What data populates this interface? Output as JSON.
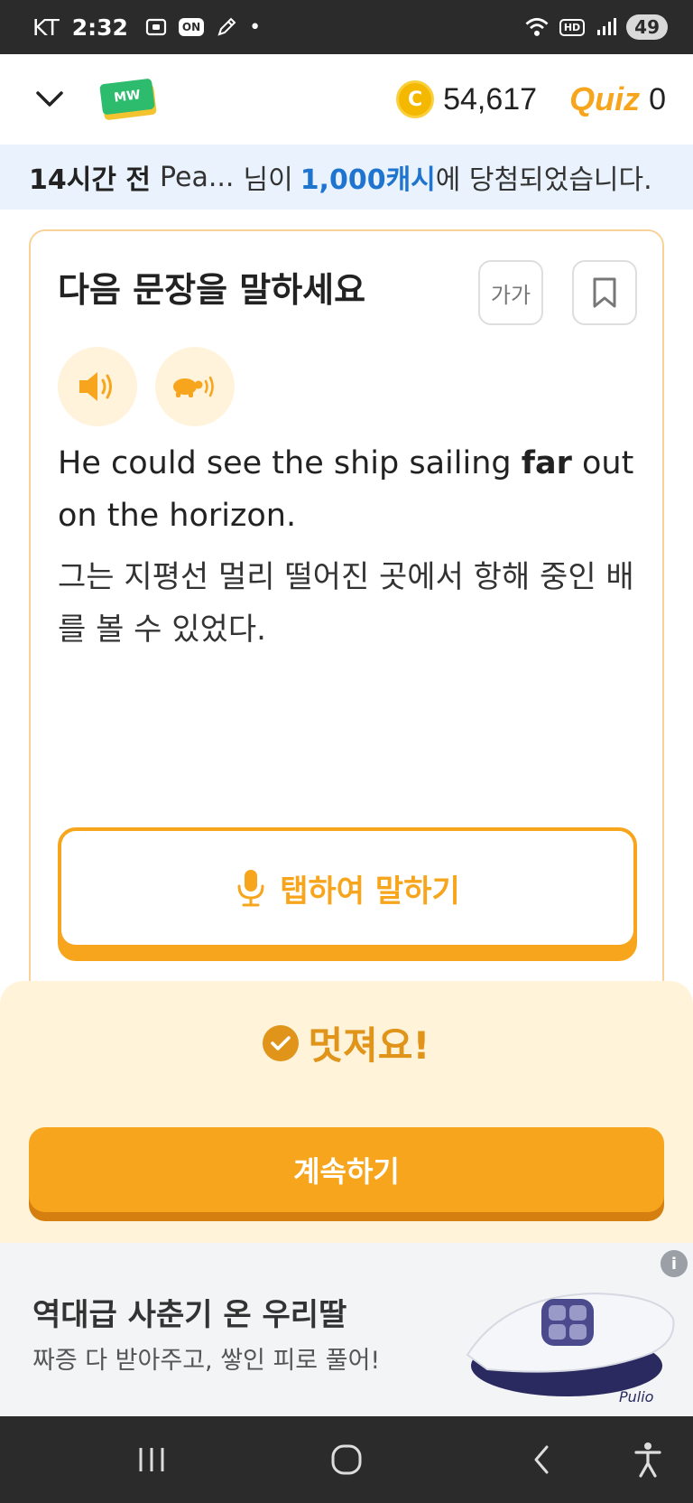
{
  "status_bar": {
    "carrier": "KT",
    "time": "2:32",
    "on_badge": "ON",
    "dot": "•",
    "hd_badge": "HD",
    "battery": "49",
    "icons": [
      "screenshot-icon",
      "pen-icon",
      "wifi-icon",
      "signal-icon"
    ]
  },
  "header": {
    "logo_text": "MW",
    "coin_symbol": "C",
    "coin_count": "54,617",
    "quiz_logo": "Quiz",
    "quiz_count": "0"
  },
  "notice": {
    "time": "14시간 전",
    "name": "Pea...",
    "text1": "님이",
    "amount": "1,000캐시",
    "text2": "에 당첨되었습니다."
  },
  "card": {
    "title": "다음 문장을 말하세요",
    "font_size_label": "가가",
    "sentence_en_before": "He could see the ship sailing ",
    "sentence_en_bold": "far",
    "sentence_en_after": " out on the horizon.",
    "sentence_ko": "그는 지평선 멀리 떨어진 곳에서 항해 중인 배를 볼 수 있었다.",
    "speak_label": "탭하여 말하기"
  },
  "result": {
    "message": "멋져요!",
    "continue_label": "계속하기"
  },
  "ad": {
    "title": "역대급 사춘기 온 우리딸",
    "subtitle": "짜증 다 받아주고, 쌓인 피로 풀어!",
    "info": "i",
    "product_brand": "Pulio"
  },
  "colors": {
    "accent": "#f7a51c",
    "accent_dark": "#e0941a",
    "link_blue": "#1f74d0",
    "notice_bg": "#eaf3fd",
    "result_bg": "#fff4d9"
  }
}
